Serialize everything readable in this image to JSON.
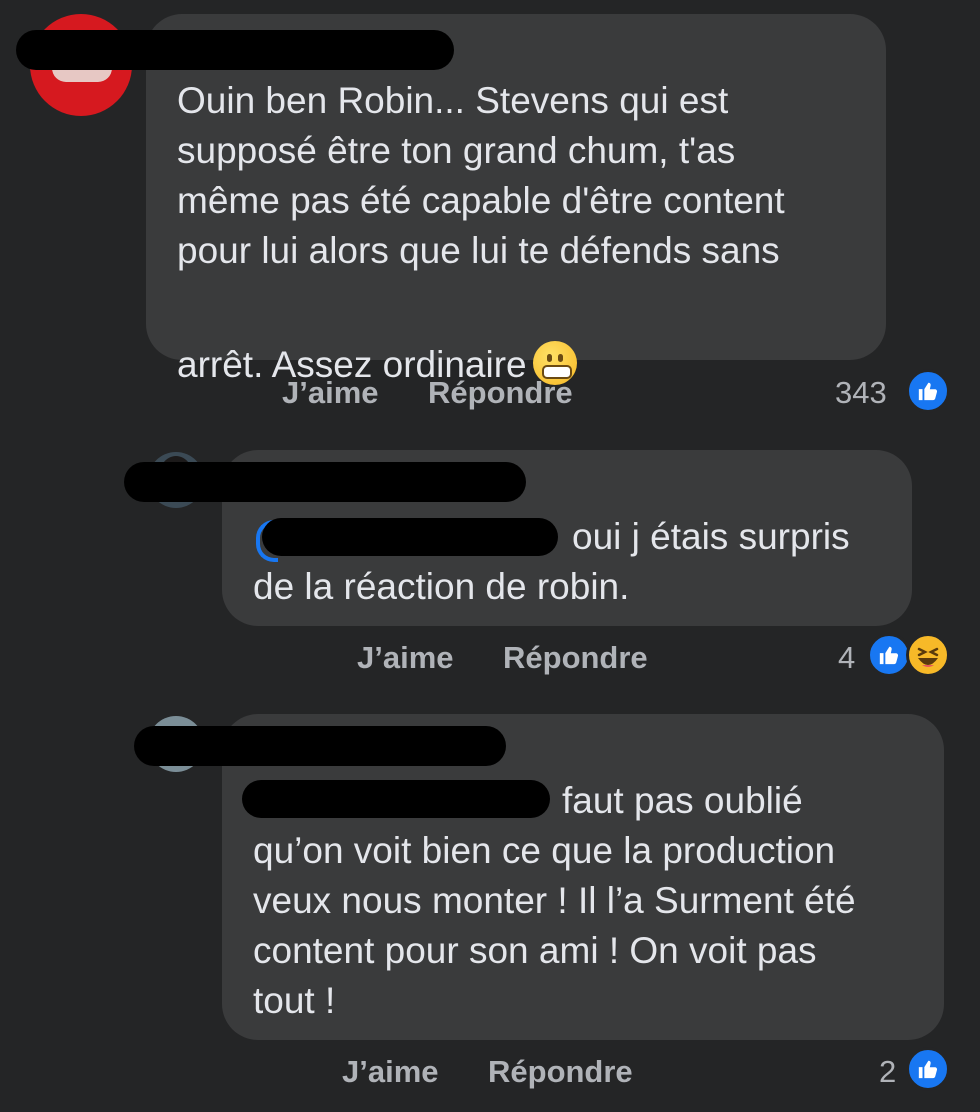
{
  "comments": [
    {
      "text_main": "Ouin ben Robin... Stevens qui est\nsupposé être ton grand chum, t'as\nmême pas été capable d'être content\npour lui alors que lui te défends sans",
      "text_last": "arrêt. Assez ordinaire",
      "emoji": "grimacing-face-emoji",
      "like_label": "J’aime",
      "reply_label": "Répondre",
      "reaction_count": "343",
      "reactions": [
        "like"
      ]
    },
    {
      "mention_text": "oui j étais surpris",
      "text": "de la réaction de robin.",
      "like_label": "J’aime",
      "reply_label": "Répondre",
      "reaction_count": "4",
      "reactions": [
        "like",
        "haha"
      ]
    },
    {
      "mention_text": "faut pas oublié",
      "text": "qu’on voit bien ce que la production\nveux nous monter ! Il l’a Surment été\ncontent pour son ami ! On voit pas\ntout !",
      "like_label": "J’aime",
      "reply_label": "Répondre",
      "reaction_count": "2",
      "reactions": [
        "like"
      ]
    }
  ],
  "colors": {
    "background": "#242526",
    "bubble": "#3a3b3c",
    "text": "#e4e6eb",
    "secondary_text": "#b0b3b8",
    "like_blue": "#1877f2"
  }
}
